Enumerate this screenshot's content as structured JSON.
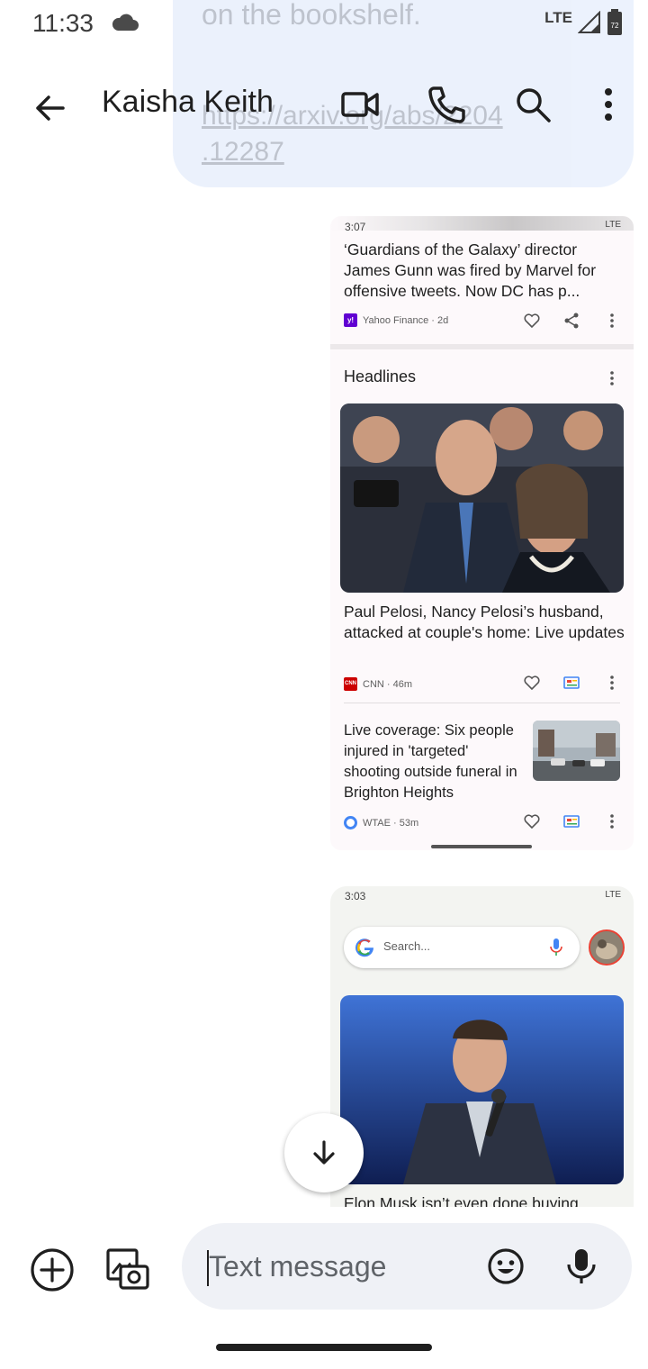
{
  "status_bar": {
    "time": "11:33",
    "network": "LTE",
    "battery": "72"
  },
  "app_bar": {
    "back_label": "Back",
    "contact_name": "Kaisha Keith"
  },
  "previous_message": {
    "line1": "on the bookshelf.",
    "line2": "https://arxiv.org/abs/2204",
    "line3": ".12287"
  },
  "screenshot1": {
    "mini_time": "3:07",
    "mini_network": "LTE",
    "story1": {
      "text": "‘Guardians of the Galaxy’ director James Gunn was fired by Marvel for offensive tweets. Now DC has p...",
      "source": "Yahoo Finance · 2d"
    },
    "section_title": "Headlines",
    "story2": {
      "text": "Paul Pelosi, Nancy Pelosi’s husband, attacked at couple's home: Live updates",
      "source": "CNN · 46m"
    },
    "story3": {
      "text": "Live coverage: Six people injured in 'targeted' shooting outside funeral in Brighton Heights",
      "source": "WTAE · 53m"
    }
  },
  "screenshot2": {
    "mini_time": "3:03",
    "mini_network": "LTE",
    "search_placeholder": "Search...",
    "story_title": "Elon Musk isn’t even done buying"
  },
  "compose": {
    "placeholder": "Text message"
  },
  "colors": {
    "accent": "#1a73e8",
    "bubble": "#dce7fb",
    "field": "#eff1f6"
  }
}
